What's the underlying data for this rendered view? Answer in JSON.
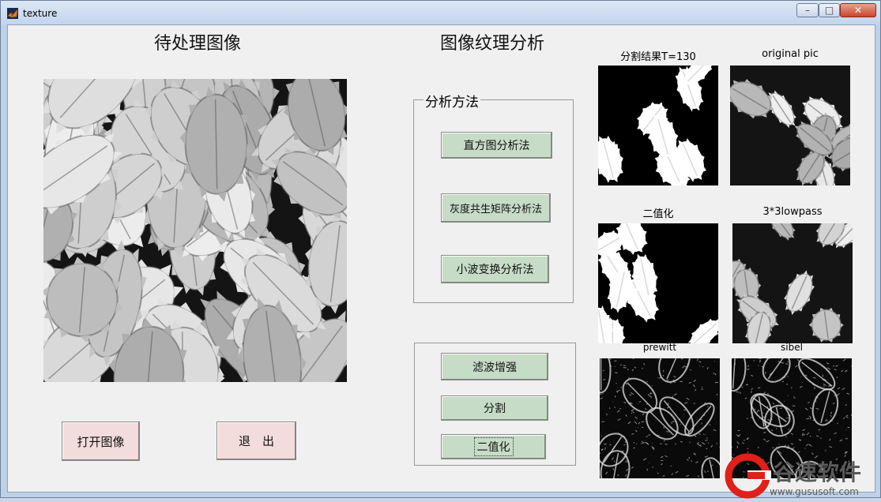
{
  "window": {
    "title": "texture",
    "controls": {
      "minimize": "–",
      "maximize": "□",
      "close": "✕"
    }
  },
  "headings": {
    "left": "待处理图像",
    "center": "图像纹理分析"
  },
  "analysis_panel": {
    "legend": "分析方法",
    "buttons": [
      "直方图分析法",
      "灰度共生矩阵分析法",
      "小波变换分析法"
    ]
  },
  "process_panel": {
    "buttons": [
      "滤波增强",
      "分割",
      "二值化"
    ]
  },
  "bottom_buttons": {
    "open": "打开图像",
    "exit": "退　出"
  },
  "thumbnails": [
    {
      "title": "分割结果T=130",
      "style": "binary"
    },
    {
      "title": "original pic",
      "style": "gray"
    },
    {
      "title": "二值化",
      "style": "binary"
    },
    {
      "title": "3*3lowpass",
      "style": "gray"
    },
    {
      "title": "prewitt",
      "style": "edge"
    },
    {
      "title": "sibel",
      "style": "edge"
    }
  ],
  "watermark": {
    "brand": "谷速软件",
    "url": "www.gususoft.com",
    "colors": {
      "red": "#e0201a",
      "gray": "#5a5a5a"
    }
  }
}
